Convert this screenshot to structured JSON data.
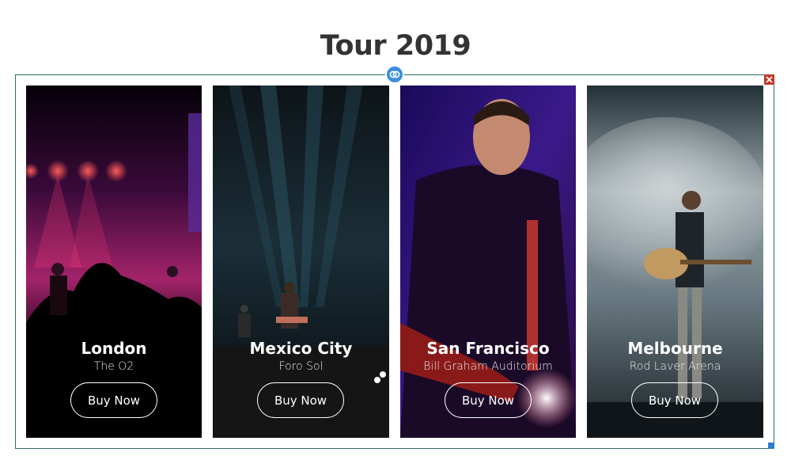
{
  "page": {
    "title": "Tour 2019"
  },
  "editor": {
    "link_icon": "link-icon",
    "close_icon": "close-icon",
    "accent_color": "#3b8ee0",
    "close_color": "#c0392b"
  },
  "cards": [
    {
      "city": "London",
      "venue": "The O2",
      "button_label": "Buy Now"
    },
    {
      "city": "Mexico City",
      "venue": "Foro Sol",
      "button_label": "Buy Now"
    },
    {
      "city": "San Francisco",
      "venue": "Bill Graham Auditorium",
      "button_label": "Buy Now"
    },
    {
      "city": "Melbourne",
      "venue": "Rod Laver Arena",
      "button_label": "Buy Now"
    }
  ]
}
